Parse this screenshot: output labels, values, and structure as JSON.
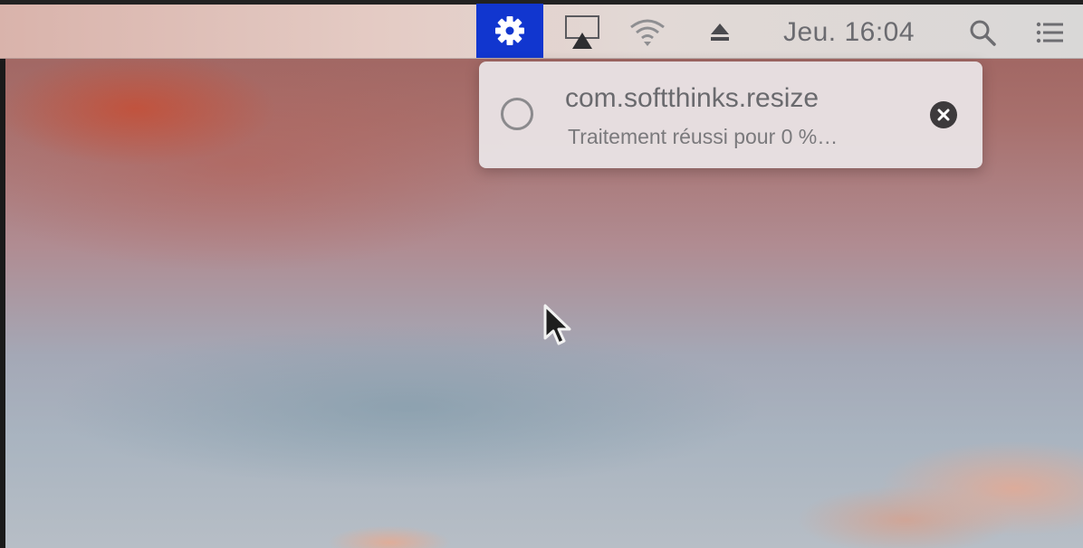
{
  "menubar": {
    "icons": {
      "gear": "gear-icon",
      "airplay": "airplay-icon",
      "wifi": "wifi-icon",
      "eject": "eject-icon",
      "search": "search-icon",
      "notifications": "notification-center-icon"
    },
    "clock": "Jeu. 16:04",
    "gear_highlight_color": "#1136cf"
  },
  "notification": {
    "title": "com.softthinks.resize",
    "subtitle": "Traitement réussi pour 0 %…",
    "icon": "progress-spinner-icon",
    "close_icon": "close-icon"
  },
  "cursor": {
    "icon": "arrow-cursor-icon"
  }
}
